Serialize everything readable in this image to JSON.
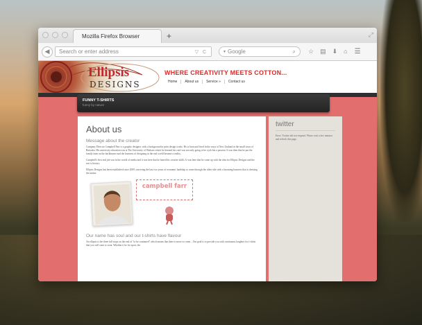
{
  "browser": {
    "tab_title": "Mozilla Firefox Browser",
    "new_tab": "+",
    "url_placeholder": "Search or enter address",
    "search_placeholder": "Google"
  },
  "site": {
    "logo_top": "Ellipsis",
    "logo_bottom": "DESIGNS",
    "tagline": "WHERE CREATIVITY MEETS COTTON...",
    "nav": [
      "Home",
      "About us",
      "Service »",
      "Contact us"
    ],
    "banner_title": "FUNNY T-SHIRTS",
    "banner_sub": "funny by nature"
  },
  "content": {
    "heading": "About us",
    "section1": "Message about the creator",
    "para1": "Company Director Campbell Farr is a graphic designer, with a background in print design works. He is born and lived in the ways of New Zealand in the small town of Raiwaka. His university education was at The University of Waikato where he learned his craft was not only going to be a job but a passion. It was then that he put the family farm on the backburner and the business of designing in the real world became a reality.",
    "para2": "Campbell's first real job was in the world of media and it was here that he honed his creative skills. It was here that he came up with the idea for Ellipsis Designs and the rest is history.",
    "para3": "Ellipsis Designs has been established since 2009, surviving the last two years of economic hardship to come through the other side with a booming business that is dressing the nation.",
    "name_stamp": "campbell farr",
    "section2": "Our name has soul and our t-shirts have flavour",
    "para4": "An ellipsis is the three full stops on the end of \"to be continued\" which means that there is more to come... Our goal is to provide you with continuous laughter for t-shirts that you will want to wear. Whether it be for sport, the"
  },
  "sidebar": {
    "title": "twitter",
    "text": "Error: Twitter did not respond. Please wait a few minutes and refresh this page."
  },
  "colors": {
    "accent": "#c4262e",
    "background": "#e36e6e"
  }
}
